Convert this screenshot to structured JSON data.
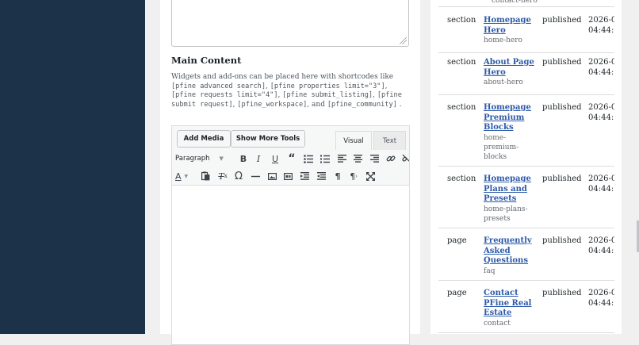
{
  "main": {
    "section_title": "Main Content",
    "help": {
      "intro": "Widgets and add-ons can be placed here with shortcodes like",
      "shortcodes": [
        "[pfine advanced search]",
        "[pfine properties limit=\"3\"]",
        "[pfine requests limit=\"4\"]",
        "[pfine submit_listing]",
        "[pfine submit request]",
        "[pfine_workspace]",
        "[pfine_community]"
      ],
      "sep": ",",
      "and": ", and",
      "end": "."
    },
    "editor": {
      "add_media": "Add Media",
      "show_more_tools": "Show More Tools",
      "tab_visual": "Visual",
      "tab_text": "Text",
      "format": "Paragraph"
    }
  },
  "right": {
    "top_slug": "contact-hero",
    "rows": [
      {
        "type": "section",
        "title": [
          "Homepage",
          "Hero"
        ],
        "slug": [
          "home-hero"
        ],
        "status": "published",
        "date": [
          "2026-0",
          "04:44:"
        ]
      },
      {
        "type": "section",
        "title": [
          "About Page",
          "Hero"
        ],
        "slug": [
          "about-hero"
        ],
        "status": "published",
        "date": [
          "2026-0",
          "04:44:"
        ]
      },
      {
        "type": "section",
        "title": [
          "Homepage",
          "Premium",
          "Blocks"
        ],
        "slug": [
          "home-",
          "premium-",
          "blocks"
        ],
        "status": "published",
        "date": [
          "2026-0",
          "04:44:"
        ]
      },
      {
        "type": "section",
        "title": [
          "Homepage",
          "Plans and",
          "Presets"
        ],
        "slug": [
          "home-plans-",
          "presets"
        ],
        "status": "published",
        "date": [
          "2026-0",
          "04:44:"
        ]
      },
      {
        "type": "page",
        "title": [
          "Frequently",
          "Asked",
          "Questions"
        ],
        "slug": [
          "faq"
        ],
        "status": "published",
        "date": [
          "2026-0",
          "04:44:"
        ]
      },
      {
        "type": "page",
        "title": [
          "Contact",
          "PFine Real",
          "Estate"
        ],
        "slug": [
          "contact"
        ],
        "status": "published",
        "date": [
          "2026-0",
          "04:44:"
        ]
      }
    ]
  },
  "toolbar_icons": {
    "row1": [
      "bold-icon",
      "italic-icon",
      "underline-icon",
      "blockquote-icon",
      "bullet-list-icon",
      "numbered-list-icon",
      "align-left-icon",
      "align-center-icon",
      "align-right-icon",
      "link-icon",
      "unlink-icon"
    ],
    "row2": [
      "text-color-icon",
      "paste-text-icon",
      "clear-formatting-icon",
      "special-character-icon",
      "horizontal-line-icon",
      "image-icon",
      "embed-icon",
      "outdent-icon",
      "indent-icon",
      "ltr-icon",
      "paragraph-icon",
      "fullscreen-icon"
    ]
  },
  "colors": {
    "sidebar": "#1c3249",
    "link": "#2d5aa8",
    "background": "#f0f0f1"
  }
}
